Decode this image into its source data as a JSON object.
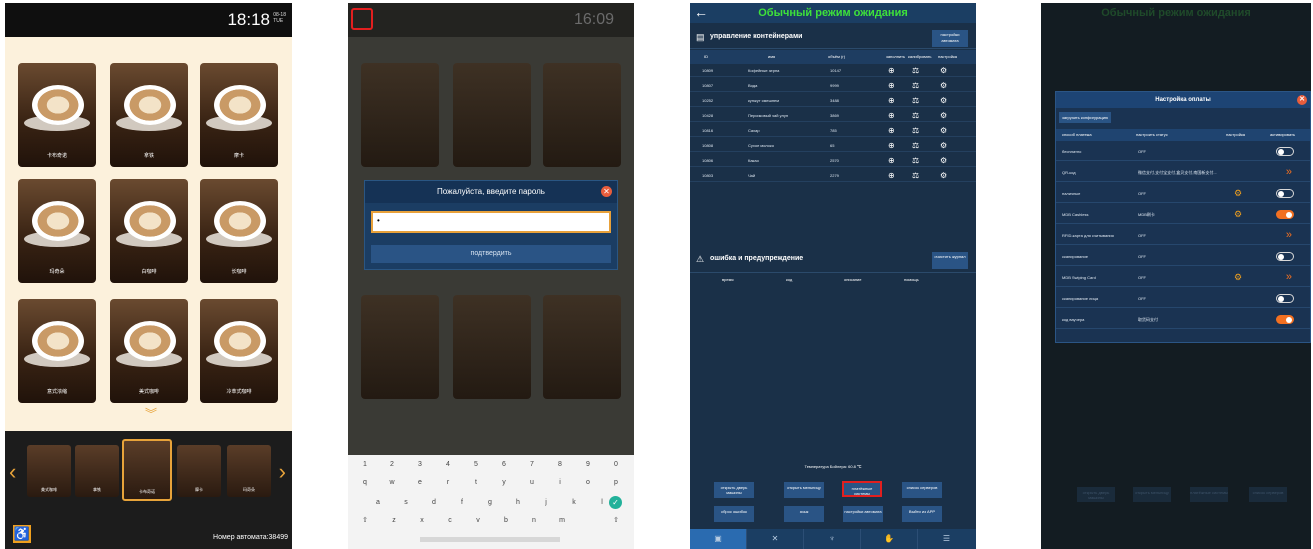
{
  "screen1": {
    "time": "18:18",
    "date": "08-18\nTUE",
    "products": [
      "卡布奇诺",
      "拿铁",
      "摩卡",
      "玛奇朵",
      "白咖啡",
      "长咖啡",
      "意式浓缩",
      "美式咖啡",
      "冷萃式咖啡"
    ],
    "carousel": [
      "美式咖啡",
      "拿铁",
      "卡布奇诺",
      "摩卡",
      "玛奇朵"
    ],
    "machine_no": "Номер автомата:38499"
  },
  "screen2": {
    "time": "16:09",
    "dialog": {
      "title": "Пожалуйста, введите пароль",
      "value": "•",
      "confirm": "подтвердить"
    },
    "keyboard": {
      "numbers": [
        "1",
        "2",
        "3",
        "4",
        "5",
        "6",
        "7",
        "8",
        "9",
        "0"
      ],
      "row1": [
        "q",
        "w",
        "e",
        "r",
        "t",
        "y",
        "u",
        "i",
        "o",
        "p"
      ],
      "row2": [
        "a",
        "s",
        "d",
        "f",
        "g",
        "h",
        "j",
        "k",
        "l"
      ],
      "row3": [
        "z",
        "x",
        "c",
        "v",
        "b",
        "n",
        "m"
      ]
    }
  },
  "screen3": {
    "title": "Обычный режим ожидания",
    "containers": {
      "title": "управление контейнерами",
      "settings_btn": "настройки автомата",
      "headers": [
        "ID",
        "имя",
        "объём (г)",
        "заполнить",
        "калибровать",
        "настройка"
      ],
      "rows": [
        {
          "id": "10809",
          "name": "Кофейные зерна",
          "vol": "10147"
        },
        {
          "id": "10807",
          "name": "Вода",
          "vol": "9999"
        },
        {
          "id": "10252",
          "name": "кунжут смешнем",
          "vol": "3488"
        },
        {
          "id": "10428",
          "name": "Персиковый чай улун",
          "vol": "3869"
        },
        {
          "id": "10816",
          "name": "Сахар",
          "vol": "785"
        },
        {
          "id": "10808",
          "name": "Сухое молоко",
          "vol": "65"
        },
        {
          "id": "10806",
          "name": "Какао",
          "vol": "2570"
        },
        {
          "id": "10803",
          "name": "Чай",
          "vol": "2279"
        }
      ]
    },
    "errors": {
      "title": "ошибка и предупреждение",
      "clear_btn": "очистить журнал",
      "headers": [
        "время",
        "код",
        "описание",
        "помощь"
      ]
    },
    "temperature": "Температура Бойлера: 60.8 ℃",
    "buttons": [
      "открыть дверь машины",
      "открыть мельницу",
      "платёжные системы",
      "список серверов",
      "сброс ошибок",
      "язык",
      "настройки автомата",
      "Выйти из APP"
    ]
  },
  "screen4": {
    "title": "Обычный режим ожидания",
    "modal": {
      "title": "Настройка оплаты",
      "load_btn": "загрузить конфигурацию",
      "headers": [
        "способ платежа",
        "настроить статус",
        "настройка",
        "активировать"
      ],
      "rows": [
        {
          "name": "бесплатно",
          "status": "OFF",
          "ctrl": "toggle-off",
          "gear": false
        },
        {
          "name": "QR-код",
          "status": "微信支付,支付宝支付,盒贝支付,南国新支付...",
          "ctrl": "chevron",
          "gear": false
        },
        {
          "name": "наличные",
          "status": "OFF",
          "ctrl": "toggle-off",
          "gear": true
        },
        {
          "name": "MDB Cashless",
          "status": "MDB刷卡",
          "ctrl": "toggle-on",
          "gear": true
        },
        {
          "name": "RFID-карта для считывания",
          "status": "OFF",
          "ctrl": "chevron",
          "gear": false
        },
        {
          "name": "сканирование",
          "status": "OFF",
          "ctrl": "toggle-off",
          "gear": false
        },
        {
          "name": "MDB Swiping Card",
          "status": "OFF",
          "ctrl": "chevron",
          "gear": true
        },
        {
          "name": "сканирование лица",
          "status": "OFF",
          "ctrl": "toggle-off",
          "gear": false
        },
        {
          "name": "код ваучера",
          "status": "取货码支付",
          "ctrl": "toggle-on",
          "gear": false
        }
      ]
    }
  },
  "colors": {
    "accent_orange": "#f27021",
    "panel_blue": "#1a3048",
    "title_green": "#3ee13a",
    "highlight_red": "#e21f1f"
  }
}
